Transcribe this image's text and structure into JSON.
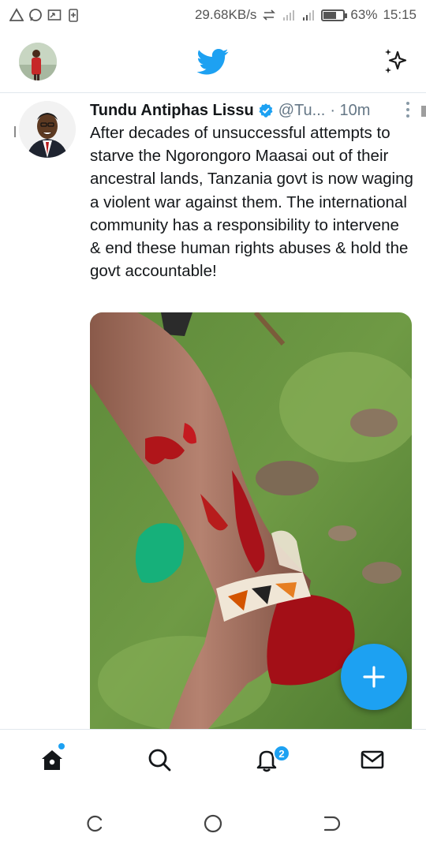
{
  "status_bar": {
    "speed": "29.68KB/s",
    "battery": "63%",
    "battery_level": 0.63,
    "time": "15:15",
    "icons": [
      "warning-triangle-icon",
      "whatsapp-icon",
      "cast-icon",
      "battery-saver-icon",
      "data-transfer-icon",
      "signal-icon",
      "wifi-icon"
    ]
  },
  "header": {
    "logo": "twitter-bird-icon",
    "brand_color": "#1da1f2",
    "action_icon": "sparkle-icon"
  },
  "tweet": {
    "name": "Tundu Antiphas Lissu",
    "verified": true,
    "handle": "@Tu...",
    "time": "· 10m",
    "text": "After decades of unsuccessful attempts to starve the Ngorongoro Maasai out of their ancestral lands, Tanzania govt is now waging a violent war against them. The international community has a responsibility to intervene & end these human rights abuses & hold the govt accountable!"
  },
  "compose": {
    "icon": "plus-icon"
  },
  "bottom_nav": {
    "items": [
      {
        "name": "home",
        "icon": "home-icon"
      },
      {
        "name": "search",
        "icon": "search-icon"
      },
      {
        "name": "notifications",
        "icon": "bell-icon"
      },
      {
        "name": "messages",
        "icon": "mail-icon"
      }
    ],
    "notification_count": "2"
  },
  "system_nav": {
    "icons": [
      "recent-apps-icon",
      "home-circle-icon",
      "back-icon"
    ]
  }
}
